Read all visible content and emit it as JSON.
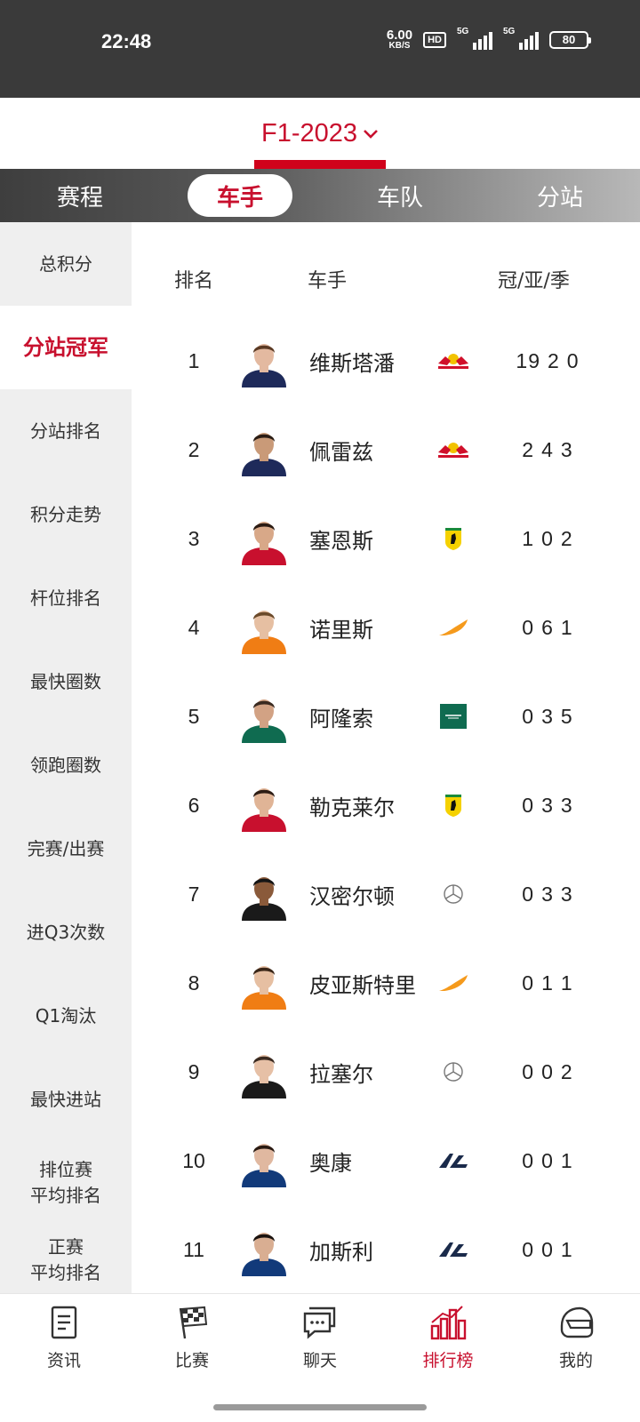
{
  "status_bar": {
    "time": "22:48",
    "net_speed_value": "6.00",
    "net_speed_unit": "KB/S",
    "hd_label": "HD",
    "signal1_label": "5G",
    "signal2_label": "5G",
    "battery": "80"
  },
  "season": {
    "label": "F1-2023",
    "icon": "chevron-down-icon"
  },
  "tabs": [
    {
      "label": "赛程",
      "active": false
    },
    {
      "label": "车手",
      "active": true
    },
    {
      "label": "车队",
      "active": false
    },
    {
      "label": "分站",
      "active": false
    }
  ],
  "sidebar": [
    {
      "label": "总积分"
    },
    {
      "label": "分站冠军",
      "active": true
    },
    {
      "label": "分站排名"
    },
    {
      "label": "积分走势"
    },
    {
      "label": "杆位排名"
    },
    {
      "label": "最快圈数"
    },
    {
      "label": "领跑圈数"
    },
    {
      "label": "完赛/出赛"
    },
    {
      "label": "进Q3次数"
    },
    {
      "label": "Q1淘汰"
    },
    {
      "label": "最快进站"
    },
    {
      "label": "排位赛\n平均排名"
    },
    {
      "label": "正赛\n平均排名"
    }
  ],
  "table_headers": {
    "rank": "排名",
    "driver": "车手",
    "stats": "冠/亚/季"
  },
  "drivers": [
    {
      "rank": "1",
      "name": "维斯塔潘",
      "team": "red-bull",
      "wins": "19",
      "seconds": "2",
      "thirds": "0",
      "suit": "#1e2a5a",
      "skin": "#e3b9a0",
      "hair": "#5b3a24"
    },
    {
      "rank": "2",
      "name": "佩雷兹",
      "team": "red-bull",
      "wins": "2",
      "seconds": "4",
      "thirds": "3",
      "suit": "#1e2a5a",
      "skin": "#c99a78",
      "hair": "#2a1c14"
    },
    {
      "rank": "3",
      "name": "塞恩斯",
      "team": "ferrari",
      "wins": "1",
      "seconds": "0",
      "thirds": "2",
      "suit": "#c8102e",
      "skin": "#d8a888",
      "hair": "#2a1a12"
    },
    {
      "rank": "4",
      "name": "诺里斯",
      "team": "mclaren",
      "wins": "0",
      "seconds": "6",
      "thirds": "1",
      "suit": "#f07d14",
      "skin": "#e6bfa2",
      "hair": "#6b4a2a"
    },
    {
      "rank": "5",
      "name": "阿隆索",
      "team": "aston-martin",
      "wins": "0",
      "seconds": "3",
      "thirds": "5",
      "suit": "#0f6b50",
      "skin": "#d2a284",
      "hair": "#3a2a20"
    },
    {
      "rank": "6",
      "name": "勒克莱尔",
      "team": "ferrari",
      "wins": "0",
      "seconds": "3",
      "thirds": "3",
      "suit": "#c8102e",
      "skin": "#e0b496",
      "hair": "#2c1c14"
    },
    {
      "rank": "7",
      "name": "汉密尔顿",
      "team": "mercedes",
      "wins": "0",
      "seconds": "3",
      "thirds": "3",
      "suit": "#1a1a1a",
      "skin": "#8a5a3a",
      "hair": "#151515"
    },
    {
      "rank": "8",
      "name": "皮亚斯特里",
      "team": "mclaren",
      "wins": "0",
      "seconds": "1",
      "thirds": "1",
      "suit": "#f07d14",
      "skin": "#e6bfa2",
      "hair": "#3a2618"
    },
    {
      "rank": "9",
      "name": "拉塞尔",
      "team": "mercedes",
      "wins": "0",
      "seconds": "0",
      "thirds": "2",
      "suit": "#1a1a1a",
      "skin": "#e6c0a6",
      "hair": "#3a2a20"
    },
    {
      "rank": "10",
      "name": "奥康",
      "team": "alpine",
      "wins": "0",
      "seconds": "0",
      "thirds": "1",
      "suit": "#123a7a",
      "skin": "#e0b8a0",
      "hair": "#2a1a12"
    },
    {
      "rank": "11",
      "name": "加斯利",
      "team": "alpine",
      "wins": "0",
      "seconds": "0",
      "thirds": "1",
      "suit": "#123a7a",
      "skin": "#d9ae92",
      "hair": "#1a120e"
    }
  ],
  "bottom_nav": [
    {
      "label": "资讯",
      "icon": "news-icon"
    },
    {
      "label": "比赛",
      "icon": "checkered-flag-icon"
    },
    {
      "label": "聊天",
      "icon": "chat-icon"
    },
    {
      "label": "排行榜",
      "icon": "ranking-chart-icon",
      "active": true
    },
    {
      "label": "我的",
      "icon": "helmet-icon"
    }
  ],
  "colors": {
    "accent": "#c8102e",
    "status_bar": "#3a3a3a",
    "sidebar_bg": "#efefef"
  }
}
